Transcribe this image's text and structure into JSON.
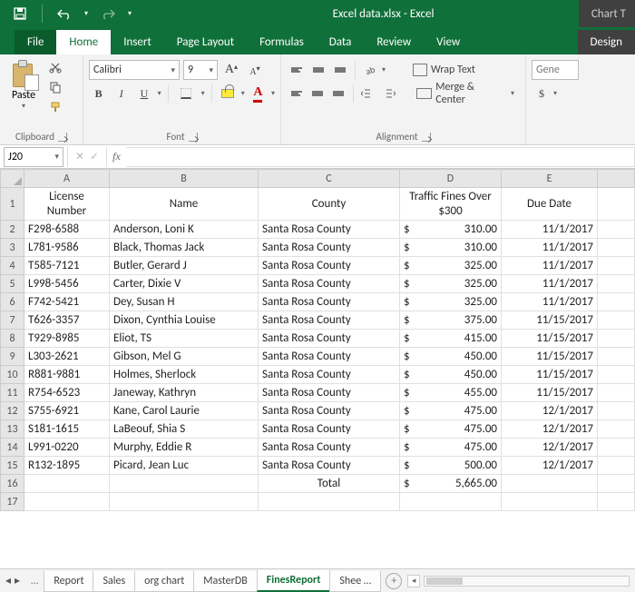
{
  "titlebar": {
    "title": "Excel data.xlsx - Excel",
    "chart_tools": "Chart T"
  },
  "tabs": {
    "file": "File",
    "home": "Home",
    "insert": "Insert",
    "pagelayout": "Page Layout",
    "formulas": "Formulas",
    "data": "Data",
    "review": "Review",
    "view": "View",
    "design": "Design"
  },
  "ribbon": {
    "paste_label": "Paste",
    "clipboard_label": "Clipboard",
    "font_name": "Calibri",
    "font_size": "9",
    "font_label": "Font",
    "wrap_label": "Wrap Text",
    "merge_label": "Merge & Center",
    "alignment_label": "Alignment",
    "number_format": "Gene",
    "dollar": "$"
  },
  "formula_bar": {
    "name_box": "J20",
    "fx": "fx",
    "value": ""
  },
  "columns": [
    "A",
    "B",
    "C",
    "D",
    "E"
  ],
  "headers": {
    "a": "License Number",
    "b": "Name",
    "c": "County",
    "d": "Traffic Fines Over $300",
    "e": "Due Date"
  },
  "rows": [
    {
      "lic": "F298-6588",
      "name": "Anderson, Loni K",
      "county": "Santa Rosa County",
      "fine": "310.00",
      "due": "11/1/2017"
    },
    {
      "lic": "L781-9586",
      "name": "Black, Thomas Jack",
      "county": "Santa Rosa County",
      "fine": "310.00",
      "due": "11/1/2017"
    },
    {
      "lic": "T585-7121",
      "name": "Butler, Gerard J",
      "county": "Santa Rosa County",
      "fine": "325.00",
      "due": "11/1/2017"
    },
    {
      "lic": "L998-5456",
      "name": "Carter, Dixie V",
      "county": "Santa Rosa County",
      "fine": "325.00",
      "due": "11/1/2017"
    },
    {
      "lic": "F742-5421",
      "name": "Dey, Susan H",
      "county": "Santa Rosa County",
      "fine": "325.00",
      "due": "11/1/2017"
    },
    {
      "lic": "T626-3357",
      "name": "Dixon, Cynthia Louise",
      "county": "Santa Rosa County",
      "fine": "375.00",
      "due": "11/15/2017"
    },
    {
      "lic": "T929-8985",
      "name": "Eliot, TS",
      "county": "Santa Rosa County",
      "fine": "415.00",
      "due": "11/15/2017"
    },
    {
      "lic": "L303-2621",
      "name": "Gibson, Mel G",
      "county": "Santa Rosa County",
      "fine": "450.00",
      "due": "11/15/2017"
    },
    {
      "lic": "R881-9881",
      "name": "Holmes, Sherlock",
      "county": "Santa Rosa County",
      "fine": "450.00",
      "due": "11/15/2017"
    },
    {
      "lic": "R754-6523",
      "name": "Janeway, Kathryn",
      "county": "Santa Rosa County",
      "fine": "455.00",
      "due": "11/15/2017"
    },
    {
      "lic": "S755-6921",
      "name": "Kane, Carol Laurie",
      "county": "Santa Rosa County",
      "fine": "475.00",
      "due": "12/1/2017"
    },
    {
      "lic": "S181-1615",
      "name": "LaBeouf, Shia S",
      "county": "Santa Rosa County",
      "fine": "475.00",
      "due": "12/1/2017"
    },
    {
      "lic": "L991-0220",
      "name": "Murphy, Eddie R",
      "county": "Santa Rosa County",
      "fine": "475.00",
      "due": "12/1/2017"
    },
    {
      "lic": "R132-1895",
      "name": "Picard, Jean Luc",
      "county": "Santa Rosa County",
      "fine": "500.00",
      "due": "12/1/2017"
    }
  ],
  "total": {
    "label": "Total",
    "value": "5,665.00",
    "currency": "$"
  },
  "sheets": {
    "items": [
      "Report",
      "Sales",
      "org chart",
      "MasterDB",
      "FinesReport",
      "Shee …"
    ],
    "active_index": 4,
    "ellipsis": "…"
  }
}
